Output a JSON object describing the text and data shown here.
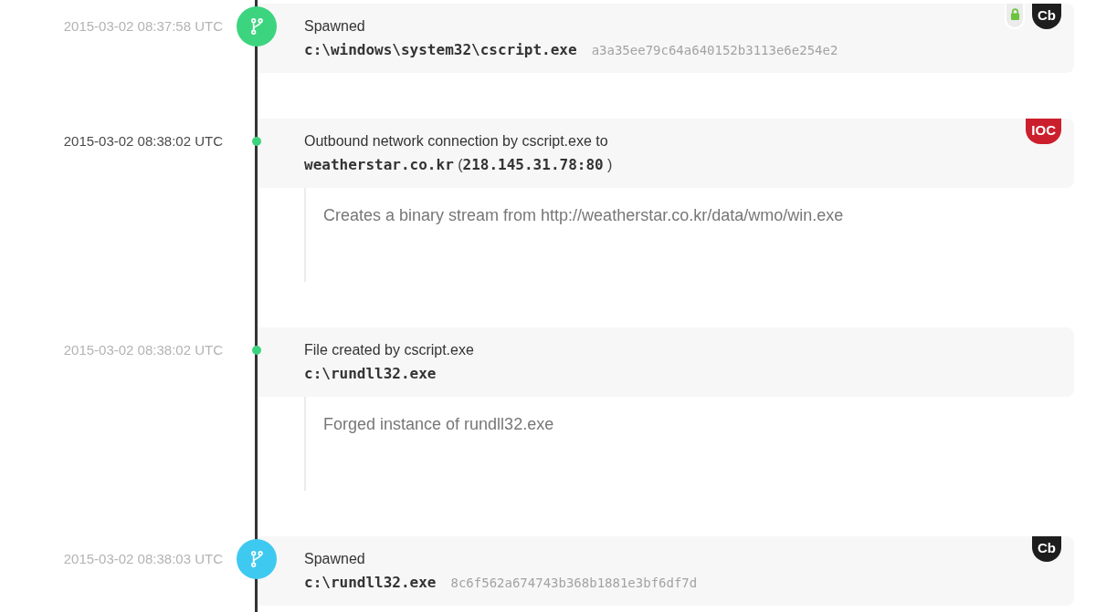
{
  "events": [
    {
      "timestamp": "2015-03-02 08:37:58 UTC",
      "timestamp_dimmed": true,
      "node": {
        "kind": "icon",
        "color": "#3dd47f"
      },
      "title": "Spawned",
      "path": "c:\\windows\\system32\\cscript.exe",
      "hash": "a3a35ee79c64a640152b3113e6e254e2",
      "badges": [
        {
          "kind": "lock"
        },
        {
          "kind": "label",
          "text": "Cb",
          "color": "#1e1e1e"
        }
      ]
    },
    {
      "timestamp": "2015-03-02 08:38:02 UTC",
      "timestamp_dimmed": false,
      "node": {
        "kind": "dot",
        "color": "#3dd47f"
      },
      "title": "Outbound network connection by cscript.exe to",
      "target": "**weatherstar.co.kr** (**218.145.31.78:80** )",
      "badges": [
        {
          "kind": "label",
          "text": "IOC",
          "color": "#cc1f2d"
        }
      ],
      "note": "Creates a binary stream from http://weatherstar.co.kr/data/wmo/win.exe"
    },
    {
      "timestamp": "2015-03-02 08:38:02 UTC",
      "timestamp_dimmed": true,
      "node": {
        "kind": "dot",
        "color": "#3dd47f"
      },
      "title": "File created by cscript.exe",
      "path": "c:\\rundll32.exe",
      "note": "Forged instance of rundll32.exe"
    },
    {
      "timestamp": "2015-03-02 08:38:03 UTC",
      "timestamp_dimmed": true,
      "node": {
        "kind": "icon",
        "color": "#3ec9f0"
      },
      "title": "Spawned",
      "path": "c:\\rundll32.exe",
      "hash": "8c6f562a674743b368b1881e3bf6df7d",
      "badges": [
        {
          "kind": "label",
          "text": "Cb",
          "color": "#1e1e1e"
        }
      ]
    }
  ]
}
